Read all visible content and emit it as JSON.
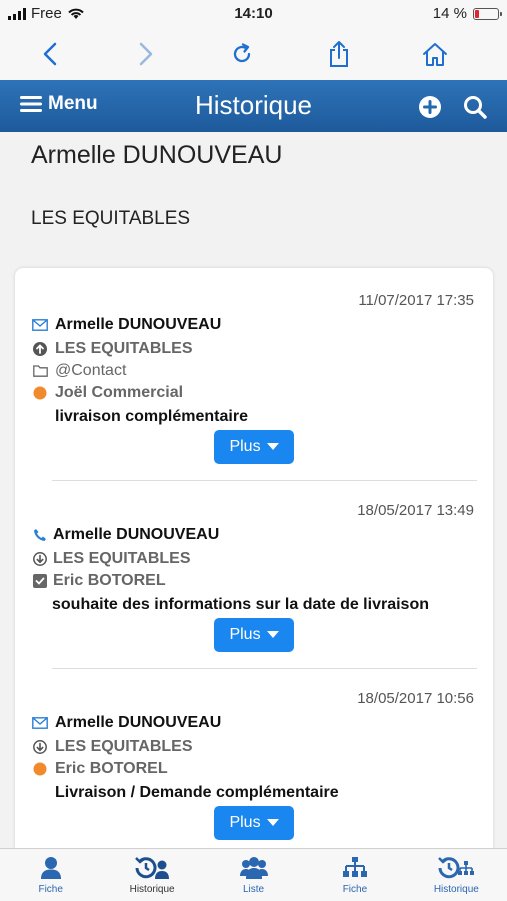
{
  "status_bar": {
    "carrier": "Free",
    "time": "14:10",
    "battery": "14 %"
  },
  "app_bar": {
    "menu_label": "Menu",
    "title": "Historique"
  },
  "contact": {
    "name": "Armelle DUNOUVEAU",
    "company": "LES EQUITABLES"
  },
  "entries": [
    {
      "date": "11/07/2017 17:35",
      "type_icon": "envelope-icon",
      "name": "Armelle DUNOUVEAU",
      "company": "LES EQUITABLES",
      "folder": "@Contact",
      "assignee": "Joël Commercial",
      "subject": "livraison complémentaire",
      "more_label": "Plus"
    },
    {
      "date": "18/05/2017 13:49",
      "type_icon": "phone-icon",
      "name": "Armelle DUNOUVEAU",
      "company": "LES EQUITABLES",
      "assignee": "Eric BOTOREL",
      "subject": "souhaite des informations sur la date de livraison",
      "more_label": "Plus"
    },
    {
      "date": "18/05/2017 10:56",
      "type_icon": "envelope-icon",
      "name": "Armelle DUNOUVEAU",
      "company": "LES EQUITABLES",
      "assignee": "Eric BOTOREL",
      "subject": "Livraison / Demande complémentaire",
      "more_label": "Plus"
    }
  ],
  "tabs": [
    {
      "label": "Fiche",
      "icon": "user-icon"
    },
    {
      "label": "Historique",
      "icon": "history-user-icon"
    },
    {
      "label": "Liste",
      "icon": "users-icon"
    },
    {
      "label": "Fiche",
      "icon": "org-chart-icon"
    },
    {
      "label": "Historique",
      "icon": "history-org-icon"
    }
  ],
  "colors": {
    "header_blue": "#2468ad",
    "button_blue": "#1a86f0",
    "status_orange": "#f08a2c",
    "icon_blue": "#2b66b1"
  }
}
